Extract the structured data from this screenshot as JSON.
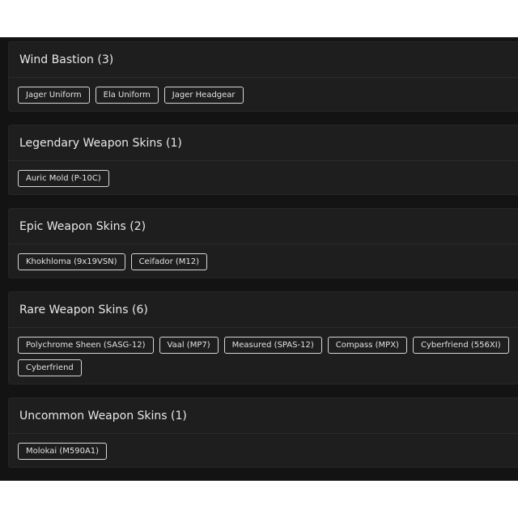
{
  "sections": [
    {
      "title": "Wind Bastion (3)",
      "items": [
        "Jager Uniform",
        "Ela Uniform",
        "Jager Headgear"
      ]
    },
    {
      "title": "Legendary Weapon Skins (1)",
      "items": [
        "Auric Mold (P-10C)"
      ]
    },
    {
      "title": "Epic Weapon Skins (2)",
      "items": [
        "Khokhloma (9x19VSN)",
        "Ceifador (M12)"
      ]
    },
    {
      "title": "Rare Weapon Skins (6)",
      "items": [
        "Polychrome Sheen (SASG-12)",
        "Vaal (MP7)",
        "Measured (SPAS-12)",
        "Compass (MPX)",
        "Cyberfriend (556XI)",
        "Cyberfriend"
      ]
    },
    {
      "title": "Uncommon Weapon Skins (1)",
      "items": [
        "Molokai (M590A1)"
      ]
    }
  ],
  "colors": {
    "background": "#131313",
    "card": "#1e1e1e",
    "chip_border": "#d6d6d6",
    "text": "#e8e8e8"
  }
}
